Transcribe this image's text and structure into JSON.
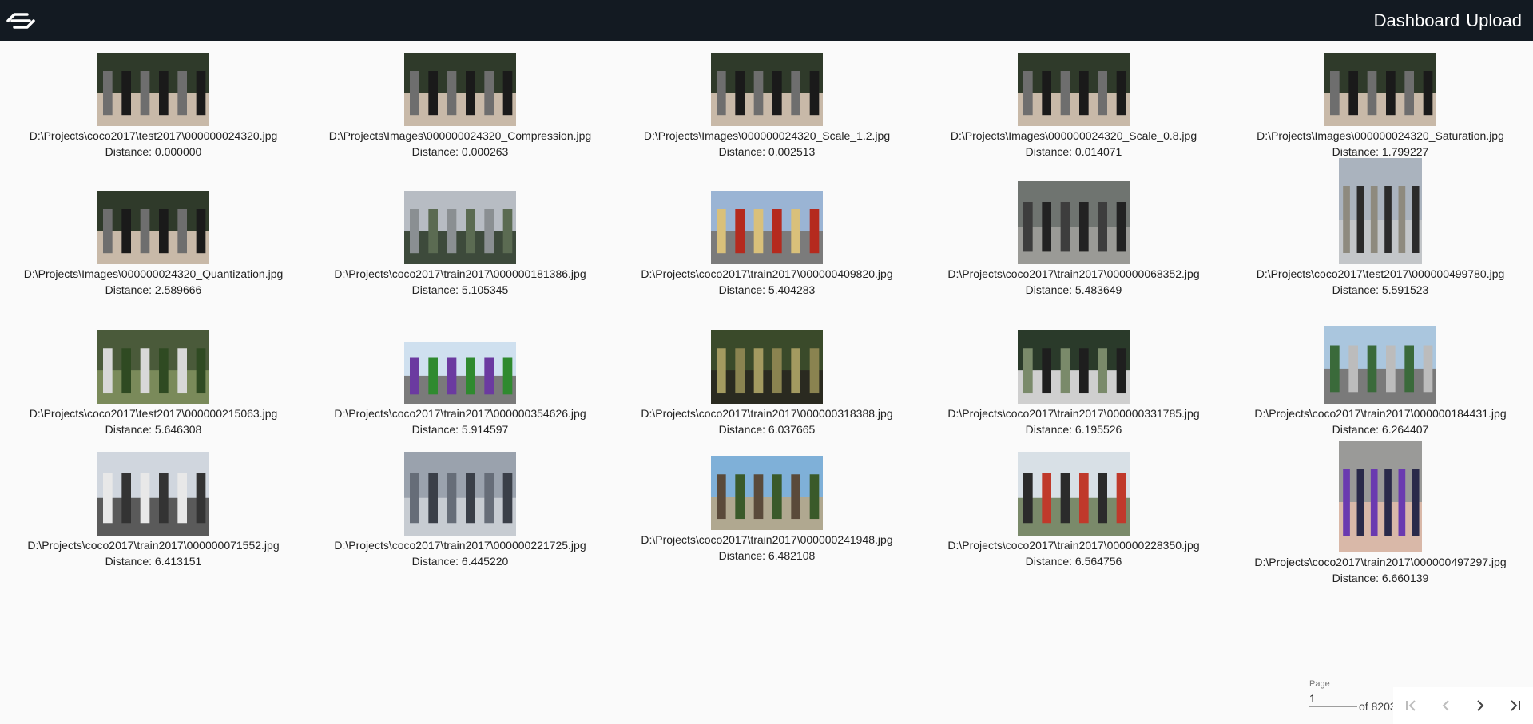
{
  "app": {
    "nav_dashboard": "Dashboard",
    "nav_upload": "Upload"
  },
  "results": [
    {
      "path": "D:\\Projects\\coco2017\\test2017\\000000024320.jpg",
      "distance": "Distance: 0.000000",
      "thumb": "people-group"
    },
    {
      "path": "D:\\Projects\\Images\\000000024320_Compression.jpg",
      "distance": "Distance: 0.000263",
      "thumb": "people-group"
    },
    {
      "path": "D:\\Projects\\Images\\000000024320_Scale_1.2.jpg",
      "distance": "Distance: 0.002513",
      "thumb": "people-group"
    },
    {
      "path": "D:\\Projects\\Images\\000000024320_Scale_0.8.jpg",
      "distance": "Distance: 0.014071",
      "thumb": "people-group"
    },
    {
      "path": "D:\\Projects\\Images\\000000024320_Saturation.jpg",
      "distance": "Distance: 1.799227",
      "thumb": "people-group"
    },
    {
      "path": "D:\\Projects\\Images\\000000024320_Quantization.jpg",
      "distance": "Distance: 2.589666",
      "thumb": "people-group"
    },
    {
      "path": "D:\\Projects\\coco2017\\train2017\\000000181386.jpg",
      "distance": "Distance: 5.105345",
      "thumb": "city-canal"
    },
    {
      "path": "D:\\Projects\\coco2017\\train2017\\000000409820.jpg",
      "distance": "Distance: 5.404283",
      "thumb": "red-train"
    },
    {
      "path": "D:\\Projects\\coco2017\\train2017\\000000068352.jpg",
      "distance": "Distance: 5.483649",
      "thumb": "steam-locomotive"
    },
    {
      "path": "D:\\Projects\\coco2017\\test2017\\000000499780.jpg",
      "distance": "Distance: 5.591523",
      "thumb": "skateboarder"
    },
    {
      "path": "D:\\Projects\\coco2017\\test2017\\000000215063.jpg",
      "distance": "Distance: 5.646308",
      "thumb": "tennis"
    },
    {
      "path": "D:\\Projects\\coco2017\\train2017\\000000354626.jpg",
      "distance": "Distance: 5.914597",
      "thumb": "green-bus"
    },
    {
      "path": "D:\\Projects\\coco2017\\train2017\\000000318388.jpg",
      "distance": "Distance: 6.037665",
      "thumb": "field"
    },
    {
      "path": "D:\\Projects\\coco2017\\train2017\\000000331785.jpg",
      "distance": "Distance: 6.195526",
      "thumb": "motorcycle"
    },
    {
      "path": "D:\\Projects\\coco2017\\train2017\\000000184431.jpg",
      "distance": "Distance: 6.264407",
      "thumb": "apartments"
    },
    {
      "path": "D:\\Projects\\coco2017\\train2017\\000000071552.jpg",
      "distance": "Distance: 6.413151",
      "thumb": "double-decker"
    },
    {
      "path": "D:\\Projects\\coco2017\\train2017\\000000221725.jpg",
      "distance": "Distance: 6.445220",
      "thumb": "beach"
    },
    {
      "path": "D:\\Projects\\coco2017\\train2017\\000000241948.jpg",
      "distance": "Distance: 6.482108",
      "thumb": "rail-yard"
    },
    {
      "path": "D:\\Projects\\coco2017\\train2017\\000000228350.jpg",
      "distance": "Distance: 6.564756",
      "thumb": "cafe"
    },
    {
      "path": "D:\\Projects\\coco2017\\train2017\\000000497297.jpg",
      "distance": "Distance: 6.660139",
      "thumb": "portrait"
    }
  ],
  "paginator": {
    "label": "Page",
    "value": "1",
    "of_text": "of 8203"
  },
  "colors": {
    "topbar": "#131a22",
    "background": "#fafafa"
  }
}
